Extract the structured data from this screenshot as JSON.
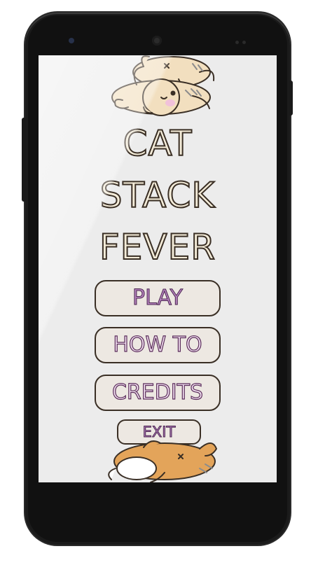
{
  "app": {
    "title_lines": [
      "CAT",
      "STACK",
      "FEVER"
    ]
  },
  "menu": {
    "play_label": "PLAY",
    "howto_label": "HOW TO",
    "credits_label": "CREDITS",
    "exit_label": "EXIT"
  },
  "colors": {
    "screen_background": "#ececec",
    "title_fill": "#f4ecd9",
    "outline": "#3a2f25",
    "play_text": "#b583bd",
    "button_text_outline": "#5a2c5a",
    "cat_orange": "#e3a45a",
    "cat_cream": "#f2dfbf"
  },
  "decorations": {
    "top_cats": "sleeping-cats-top",
    "bottom_cats": "sleeping-cats-bottom"
  }
}
